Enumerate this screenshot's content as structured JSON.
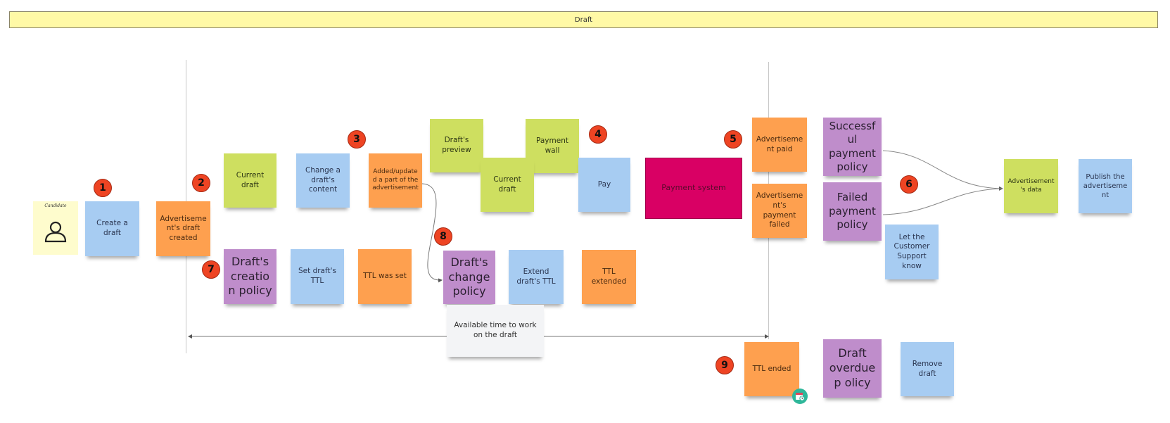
{
  "banner": {
    "title": "Draft"
  },
  "actor": {
    "label": "Candidate",
    "icon": "person-icon"
  },
  "badges": [
    "1",
    "2",
    "3",
    "4",
    "5",
    "6",
    "7",
    "8",
    "9"
  ],
  "stickies": {
    "create_draft": "Create a draft",
    "draft_created": "Advertiseme nt's draft created",
    "current_draft_1": "Current draft",
    "change_content": "Change a draft's content",
    "added_updated": "Added/updated a part of the advertisement",
    "drafts_preview": "Draft's preview",
    "current_draft_2": "Current draft",
    "payment_wall": "Payment wall",
    "pay": "Pay",
    "payment_system": "Payment system",
    "ad_paid": "Advertiseme nt paid",
    "ad_payment_failed": "Advertiseme nt's payment failed",
    "successful_policy": "Successful payment policy",
    "failed_policy": "Failed payment policy",
    "let_cs_know": "Let the Customer Support know",
    "ad_data": "Advertisement's data",
    "publish": "Publish the advertisement",
    "creation_policy": "Draft's creation policy",
    "set_ttl": "Set draft's TTL",
    "ttl_set": "TTL was set",
    "change_policy": "Draft's change policy",
    "extend_ttl": "Extend draft's TTL",
    "ttl_extended": "TTL extended",
    "available_time": "Available time to work on the draft",
    "ttl_ended": "TTL ended",
    "overdue_policy": "Draft overdue p olicy",
    "remove_draft": "Remove draft"
  },
  "colors": {
    "command": "#a7ccf2",
    "event": "#fea04f",
    "read_model": "#cedf60",
    "policy": "#bf8dcb",
    "external_system": "#d90064",
    "badge": "#ee4423"
  }
}
